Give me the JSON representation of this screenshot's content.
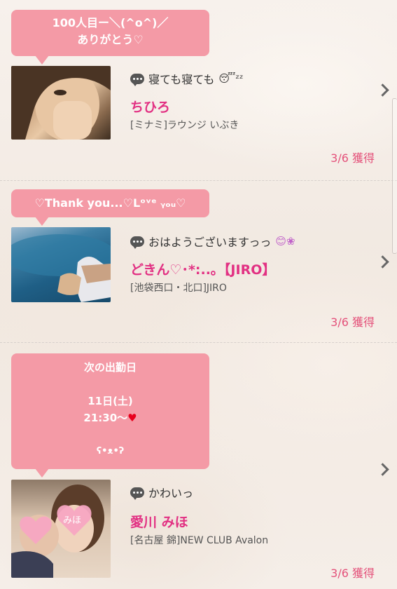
{
  "cards": [
    {
      "bubble": [
        "100人目ー＼(^o^)／",
        "ありがとう♡"
      ],
      "message": "寝ても寝ても",
      "message_suffix": "😴ᶻᶻ",
      "name": "ちひろ",
      "shop": "[ミナミ]ラウンジ いぶき",
      "count": "3/6 獲得"
    },
    {
      "bubble": [
        "♡Thank you...♡Lᵒᵛᵉ ᵧₒᵤ♡"
      ],
      "message": "おはようございますっっ",
      "message_suffix": "😊❀",
      "name": "どきん♡･*:..｡【JIRO】",
      "shop": "[池袋西口・北口]JIRO",
      "count": "3/6 獲得"
    },
    {
      "bubble": [
        "次の出勤日",
        "",
        "11日(土)",
        "21:30〜",
        "",
        "ʕ•ᴥ•ʔ"
      ],
      "bubble_heart": "♥",
      "message": "かわいっ",
      "name": "愛川 みほ",
      "shop": "[名古屋 錦]NEW CLUB Avalon",
      "count": "3/6 獲得",
      "photo_label": "みほ"
    }
  ]
}
